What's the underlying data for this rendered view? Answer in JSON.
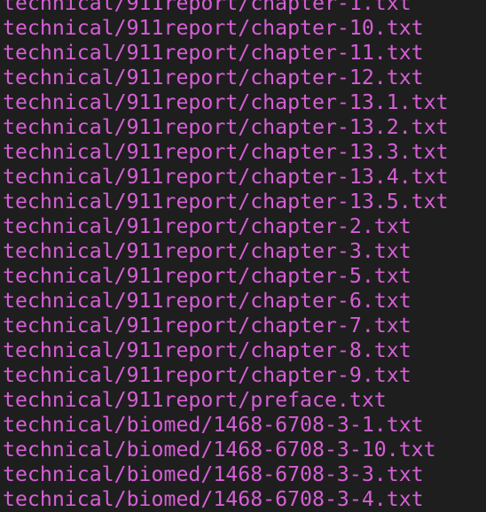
{
  "terminal": {
    "text_color": "#d65fd6",
    "background": "#1e1e1e",
    "lines": [
      "technical/911report/chapter-1.txt",
      "technical/911report/chapter-10.txt",
      "technical/911report/chapter-11.txt",
      "technical/911report/chapter-12.txt",
      "technical/911report/chapter-13.1.txt",
      "technical/911report/chapter-13.2.txt",
      "technical/911report/chapter-13.3.txt",
      "technical/911report/chapter-13.4.txt",
      "technical/911report/chapter-13.5.txt",
      "technical/911report/chapter-2.txt",
      "technical/911report/chapter-3.txt",
      "technical/911report/chapter-5.txt",
      "technical/911report/chapter-6.txt",
      "technical/911report/chapter-7.txt",
      "technical/911report/chapter-8.txt",
      "technical/911report/chapter-9.txt",
      "technical/911report/preface.txt",
      "technical/biomed/1468-6708-3-1.txt",
      "technical/biomed/1468-6708-3-10.txt",
      "technical/biomed/1468-6708-3-3.txt",
      "technical/biomed/1468-6708-3-4.txt"
    ]
  }
}
